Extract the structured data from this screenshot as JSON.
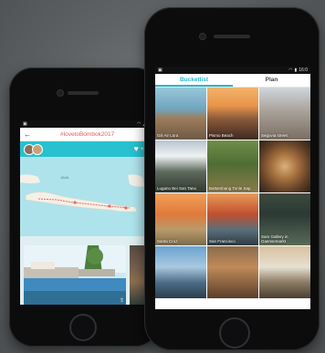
{
  "left_phone": {
    "status_icons": [
      "image-icon",
      "wifi-icon",
      "signal-icon",
      "battery-icon"
    ],
    "header": {
      "title": "#lovetoBombok2017"
    },
    "likes": "+23",
    "map_labels": [
      "JAVA"
    ]
  },
  "right_phone": {
    "status_time": "16:0",
    "tabs": [
      {
        "label": "Bucketlist",
        "active": true
      },
      {
        "label": "Plan",
        "active": false
      }
    ],
    "tiles": [
      {
        "caption": "Gili Air Lüra"
      },
      {
        "caption": "Pismo Beach"
      },
      {
        "caption": "Segovia street"
      },
      {
        "caption": "Lugano Bei San Tano"
      },
      {
        "caption": "Battambang Tonle Sap"
      },
      {
        "caption": ""
      },
      {
        "caption": "Santa Cruz"
      },
      {
        "caption": "San Francisco"
      },
      {
        "caption": "Sam Gallery in Gaensemarkt"
      },
      {
        "caption": ""
      },
      {
        "caption": ""
      },
      {
        "caption": ""
      }
    ]
  },
  "colors": {
    "accent": "#28c1cf",
    "title_red": "#e05c5c"
  }
}
